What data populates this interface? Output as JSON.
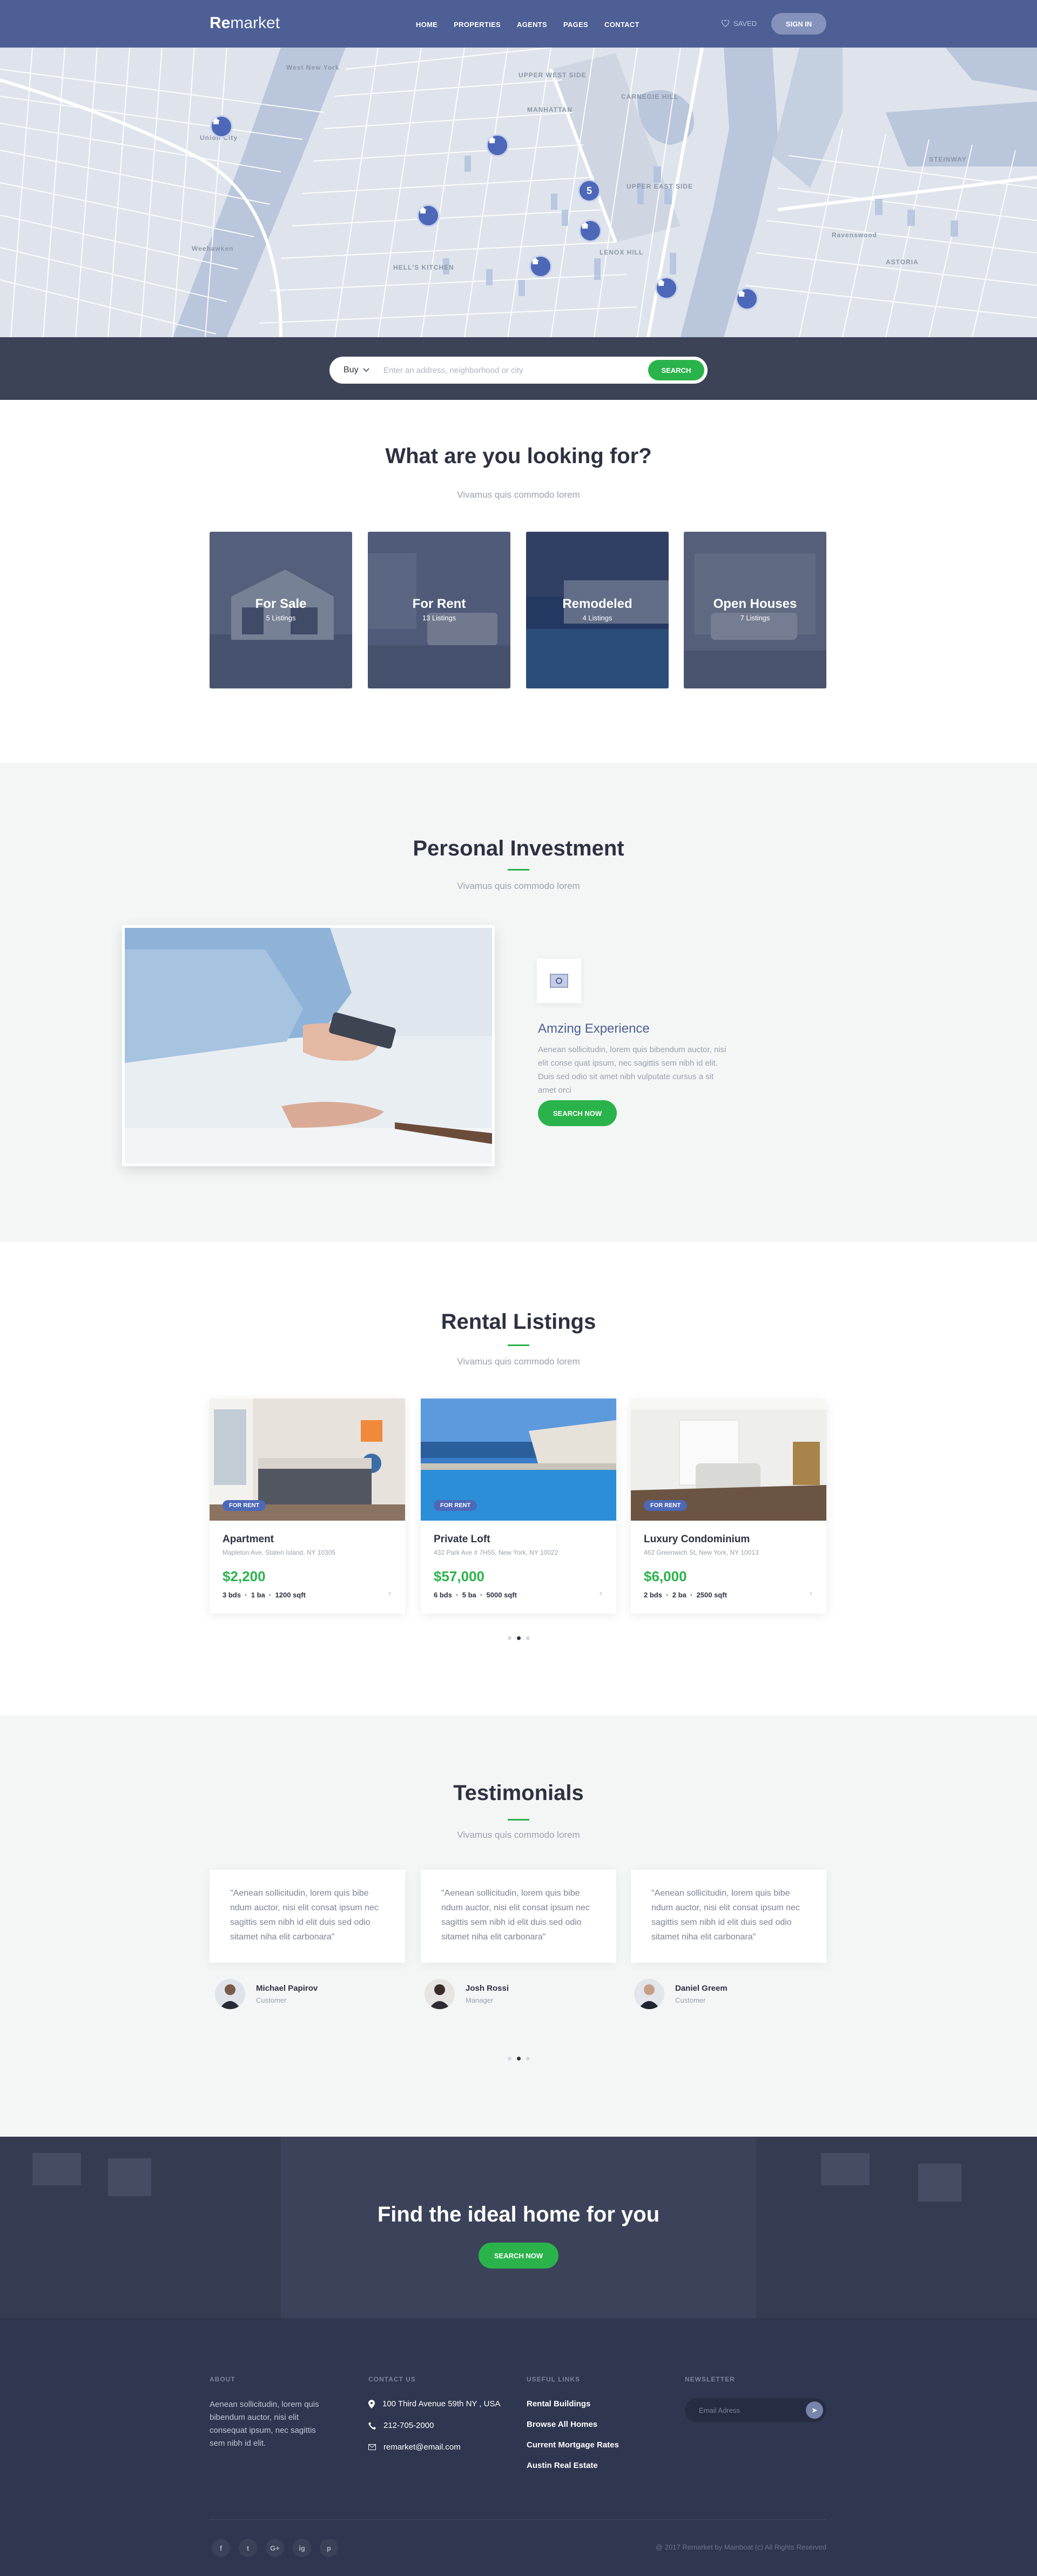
{
  "header": {
    "logo_bold": "Re",
    "logo_rest": "market",
    "nav": [
      "HOME",
      "PROPERTIES",
      "AGENTS",
      "PAGES",
      "CONTACT"
    ],
    "saved_label": "SAVED",
    "signin_label": "SIGN IN"
  },
  "map": {
    "labels": [
      "West New York",
      "Union City",
      "Weehawken",
      "UPPER WEST SIDE",
      "MANHATTAN",
      "CARNEGIE HILL",
      "UPPER EAST SIDE",
      "LENOX HILL",
      "HELL'S KITCHEN",
      "STEINWAY",
      "ASTORIA",
      "Ravenswood"
    ],
    "cluster_count": "5"
  },
  "search": {
    "mode": "Buy",
    "placeholder": "Enter an address, neighborhood or city",
    "button_label": "SEARCH"
  },
  "looking": {
    "title": "What are you looking for?",
    "subtitle": "Vivamus quis commodo lorem",
    "categories": [
      {
        "title": "For Sale",
        "count": "5 Listings"
      },
      {
        "title": "For Rent",
        "count": "13 Listings"
      },
      {
        "title": "Remodeled",
        "count": "4 Listings"
      },
      {
        "title": "Open Houses",
        "count": "7 Listings"
      }
    ]
  },
  "investment": {
    "title": "Personal Investment",
    "subtitle": "Vivamus quis commodo lorem",
    "feature_title": "Amzing  Experience",
    "feature_text": "Aenean sollicitudin, lorem quis bibendum auctor, nisi elit conse quat ipsum, nec sagittis sem nibh id elit. Duis sed odio sit amet nibh vulputate cursus a sit amet orci",
    "button_label": "SEARCH NOW"
  },
  "rentals": {
    "title": "Rental Listings",
    "subtitle": "Vivamus quis commodo lorem",
    "listings": [
      {
        "badge": "FOR RENT",
        "name": "Apartment",
        "address": "Mapleton Ave, Staten Island, NY 10305",
        "price": "$2,200",
        "beds": "3 bds",
        "baths": "1 ba",
        "area": "1200 sqft"
      },
      {
        "badge": "FOR RENT",
        "name": "Private Loft",
        "address": "432 Park Ave # 7H55, New York, NY 10022",
        "price": "$57,000",
        "beds": "6 bds",
        "baths": "5 ba",
        "area": "5000 sqft"
      },
      {
        "badge": "FOR RENT",
        "name": "Luxury Condominium",
        "address": "462 Greenwich St, New York, NY 10013",
        "price": "$6,000",
        "beds": "2 bds",
        "baths": "2 ba",
        "area": "2500 sqft"
      }
    ]
  },
  "testimonials": {
    "title": "Testimonials",
    "subtitle": "Vivamus quis commodo lorem",
    "items": [
      {
        "quote": "\"Aenean sollicitudin, lorem quis bibe ndum auctor, nisi elit consat ipsum nec sagittis sem nibh id elit duis sed odio sitamet niha elit carbonara\"",
        "name": "Michael Papirov",
        "role": "Customer"
      },
      {
        "quote": "\"Aenean sollicitudin, lorem quis bibe ndum auctor, nisi elit consat ipsum nec sagittis sem nibh id elit duis sed odio sitamet niha elit carbonara\"",
        "name": "Josh Rossi",
        "role": "Manager"
      },
      {
        "quote": "\"Aenean sollicitudin, lorem quis bibe ndum auctor, nisi elit consat ipsum nec sagittis sem nibh id elit duis sed odio sitamet niha elit carbonara\"",
        "name": "Daniel Greem",
        "role": "Customer"
      }
    ]
  },
  "cta": {
    "title": "Find the ideal home for you",
    "button_label": "SEARCH NOW"
  },
  "footer": {
    "about_title": "ABOUT",
    "about_text": "Aenean sollicitudin, lorem quis bibendum auctor, nisi elit consequat ipsum, nec sagittis sem nibh id elit.",
    "contact_title": "CONTACT US",
    "address": "100 Third Avenue 59th NY , USA",
    "phone": "212-705-2000",
    "email": "remarket@email.com",
    "links_title": "USEFUL LINKS",
    "links": [
      "Rental Buildings",
      "Browse All Homes",
      "Current Mortgage Rates",
      "Austin Real Estate"
    ],
    "newsletter_title": "NEWSLETTER",
    "newsletter_placeholder": "Email Adress",
    "social": [
      "f",
      "t",
      "G+",
      "ig",
      "p"
    ],
    "copyright": "@ 2017 Remarket by Mainboat (c) All Rights Reserved"
  },
  "colors": {
    "header": "#4d5f95",
    "accent_green": "#2bb34b",
    "pin_blue": "#4d68b8",
    "footer": "#2f3750"
  }
}
